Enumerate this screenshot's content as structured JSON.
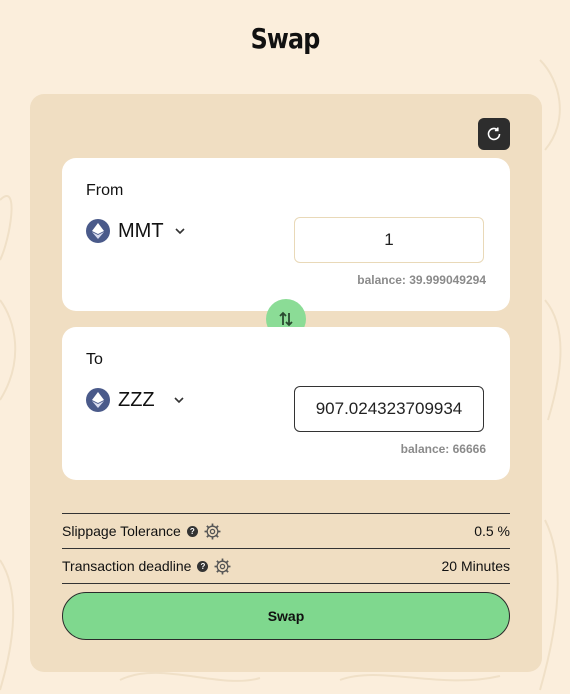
{
  "header": {
    "title": "Swap"
  },
  "from_card": {
    "label": "From",
    "token": "MMT",
    "amount": "1",
    "balance": "balance: 39.999049294"
  },
  "to_card": {
    "label": "To",
    "token": "ZZZ",
    "amount": "907.024323709934",
    "balance": "balance: 66666"
  },
  "settings": {
    "slippage_label": "Slippage Tolerance",
    "slippage_value": "0.5 %",
    "deadline_label": "Transaction deadline",
    "deadline_value": "20 Minutes",
    "help_glyph": "?"
  },
  "actions": {
    "swap_label": "Swap"
  },
  "icons": {
    "refresh": "refresh-icon",
    "token": "ethereum-icon",
    "chevron": "chevron-down-icon",
    "swap_direction": "swap-arrows-icon",
    "settings": "gear-icon"
  },
  "colors": {
    "background": "#fbeedc",
    "panel": "#f0dec2",
    "accent_green": "#7fd88e",
    "token_icon": "#4a5a8a"
  }
}
